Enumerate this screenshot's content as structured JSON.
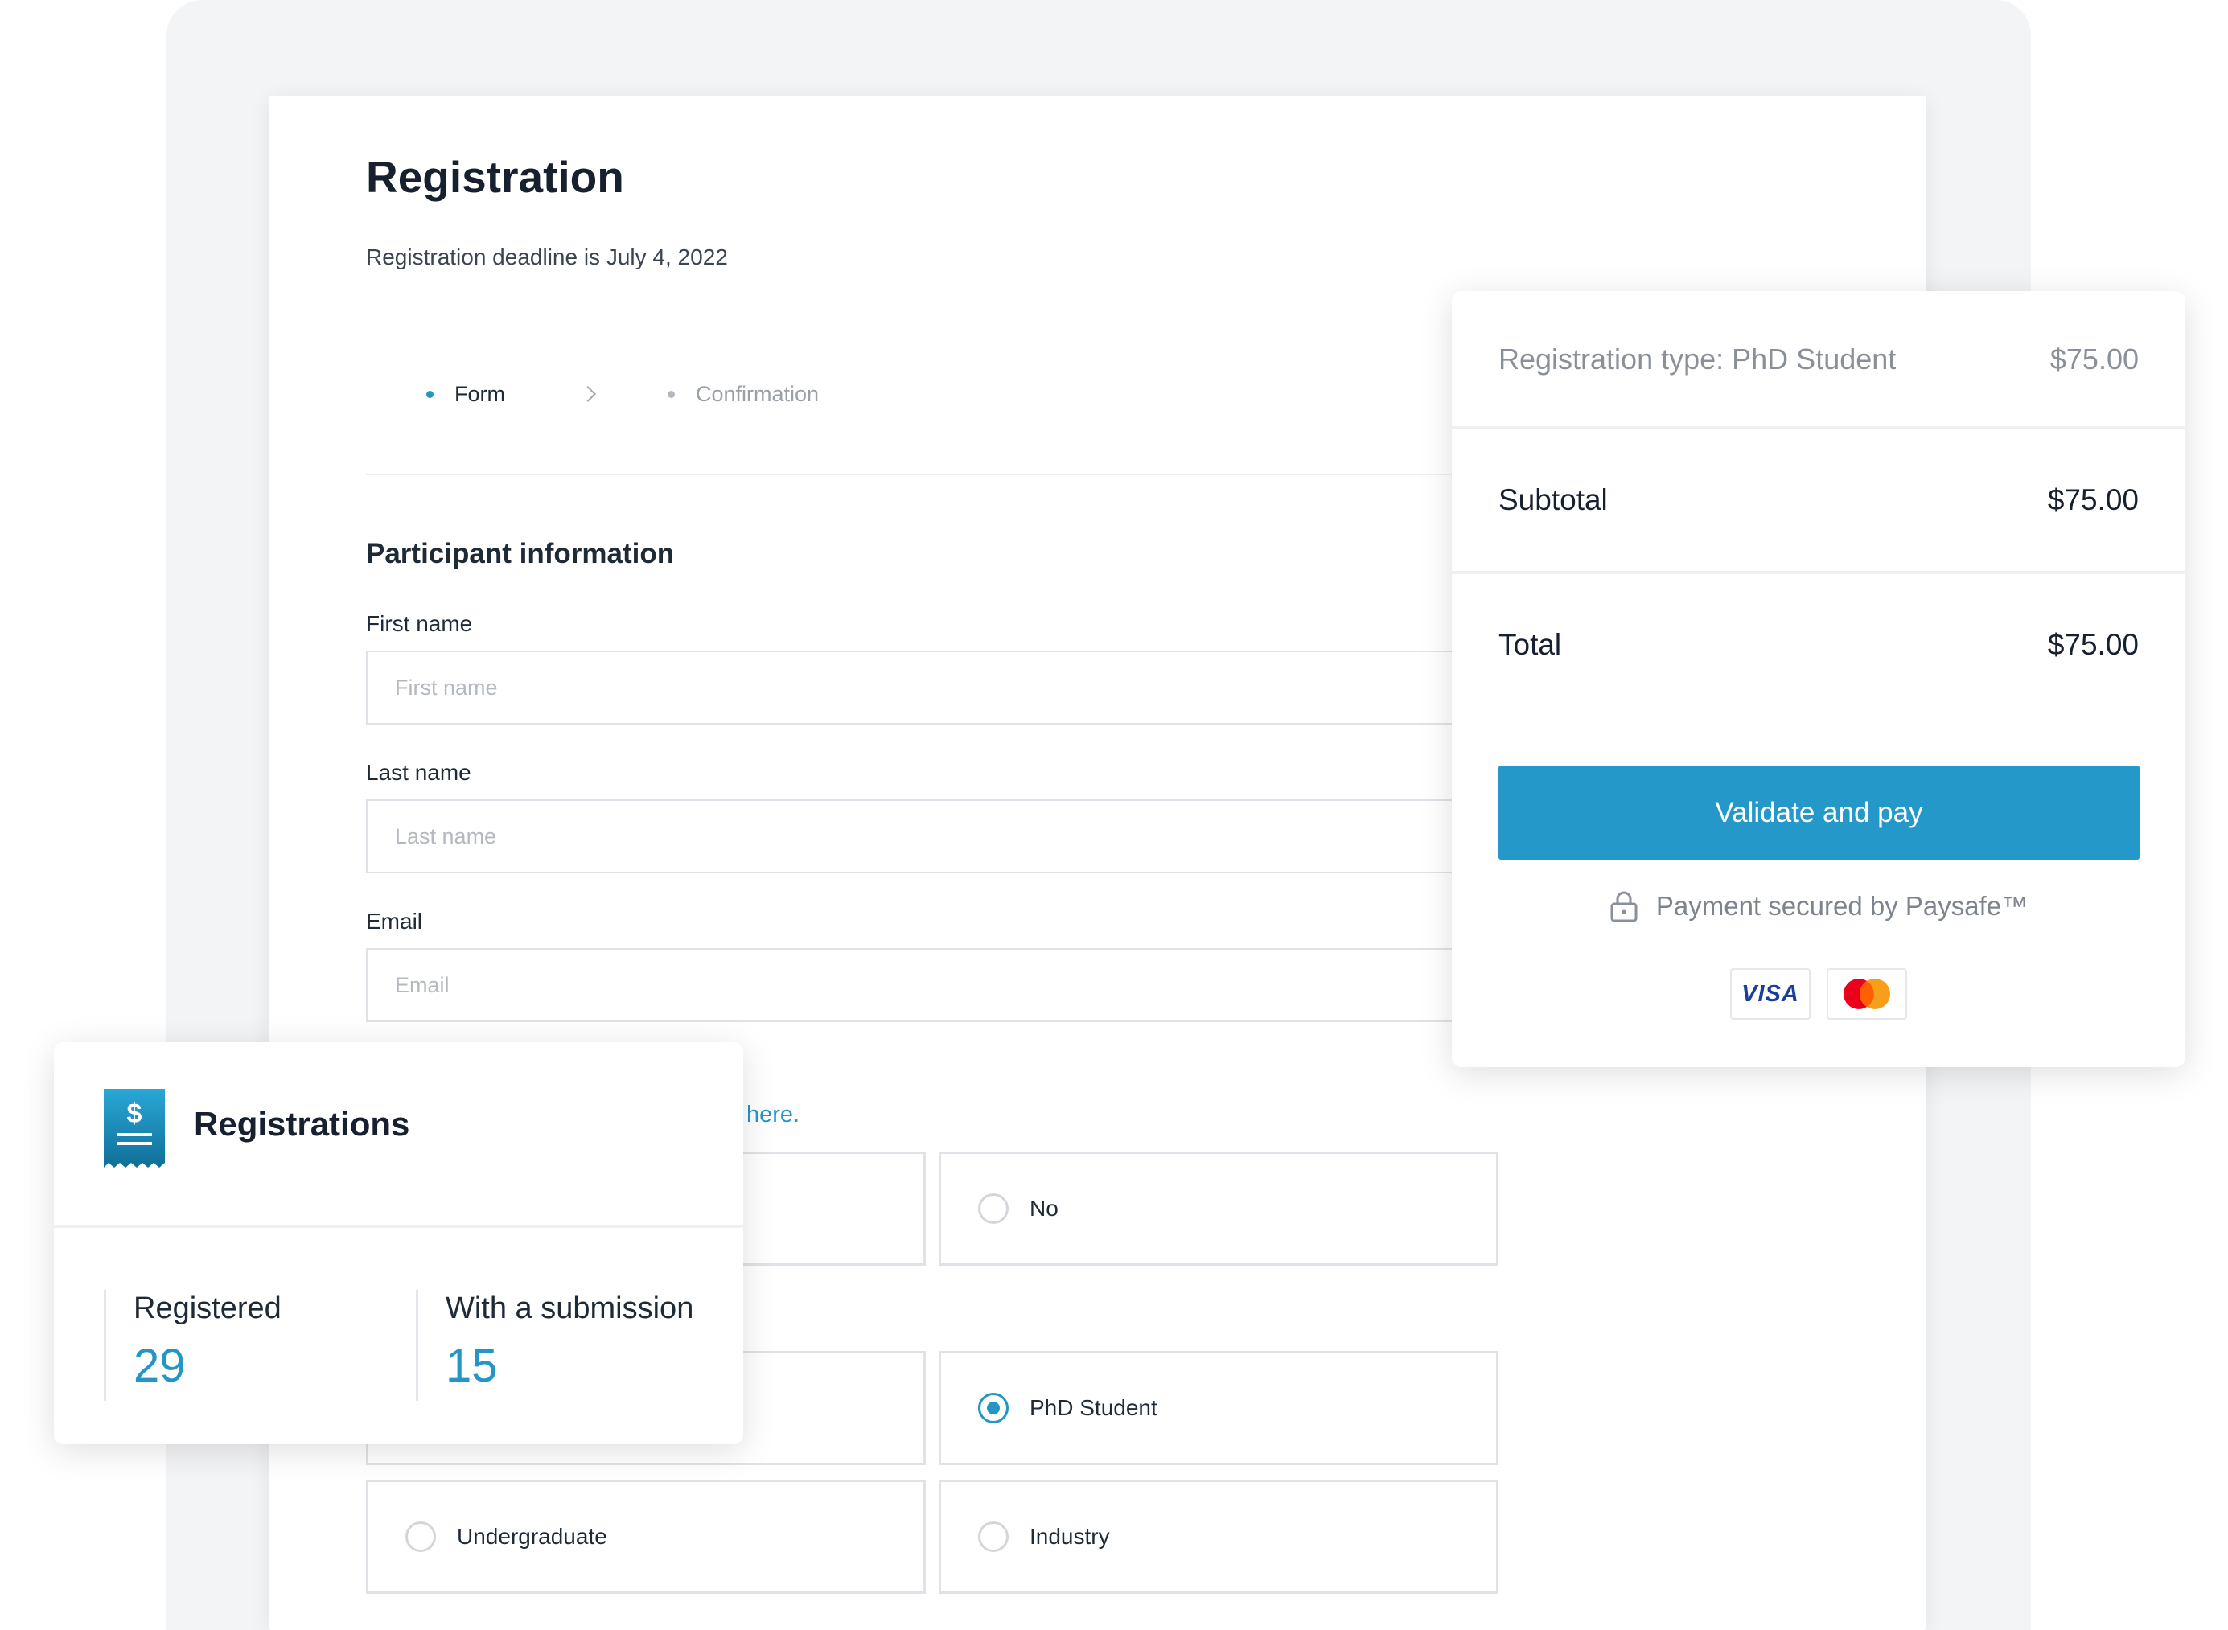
{
  "form": {
    "title": "Registration",
    "deadline": "Registration deadline is July 4, 2022",
    "steps": [
      {
        "label": "Form",
        "state": "active"
      },
      {
        "label": "Confirmation",
        "state": "inactive"
      }
    ],
    "section_title": "Participant information",
    "fields": {
      "first_name": {
        "label": "First name",
        "placeholder": "First name",
        "value": ""
      },
      "last_name": {
        "label": "Last name",
        "placeholder": "Last name",
        "value": ""
      },
      "email": {
        "label": "Email",
        "placeholder": "Email",
        "value": ""
      }
    },
    "link_text": "here.",
    "yes_no_options": {
      "no": {
        "label": "No",
        "checked": false
      }
    },
    "registration_types": {
      "phd_student": {
        "label": "PhD Student",
        "checked": true
      },
      "undergraduate": {
        "label": "Undergraduate",
        "checked": false
      },
      "industry": {
        "label": "Industry",
        "checked": false
      }
    }
  },
  "payment": {
    "type_label": "Registration type: PhD Student",
    "type_amount": "$75.00",
    "subtotal_label": "Subtotal",
    "subtotal_amount": "$75.00",
    "total_label": "Total",
    "total_amount": "$75.00",
    "pay_button": "Validate and pay",
    "secured_text": "Payment secured by Paysafe™",
    "card_logos": [
      "visa-logo",
      "mastercard-logo"
    ],
    "visa_text": "VISA"
  },
  "registrations": {
    "title": "Registrations",
    "icon": "receipt-dollar-icon",
    "stats": [
      {
        "label": "Registered",
        "value": "29"
      },
      {
        "label": "With a submission",
        "value": "15"
      }
    ]
  },
  "colors": {
    "accent": "#2396c7",
    "button": "#2398c9",
    "backdrop": "#f3f4f6",
    "text": "#17202e"
  }
}
